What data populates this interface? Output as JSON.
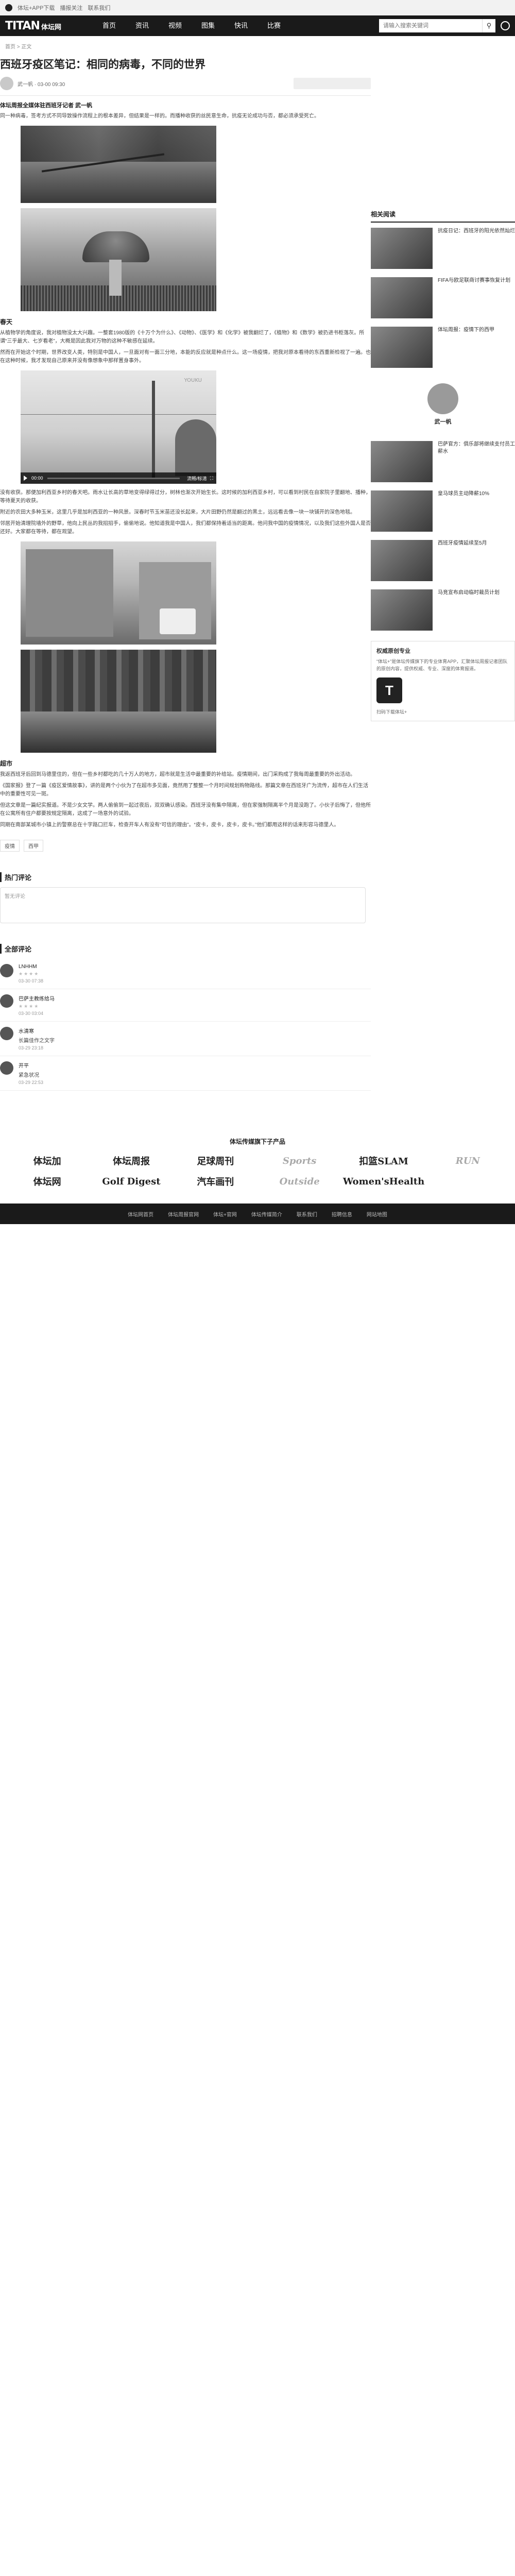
{
  "topbar": {
    "links": [
      "体坛+APP下载",
      "播报关注",
      "联系我们"
    ]
  },
  "nav": {
    "brand": "TITAN",
    "brand_sub": "体坛网",
    "menu": [
      "首页",
      "资讯",
      "视频",
      "图集",
      "快讯",
      "比赛"
    ],
    "search_placeholder": "请输入搜索关键词"
  },
  "breadcrumb": "首页 > 正文",
  "article": {
    "title": "西班牙疫区笔记：相同的病毒，不同的世界",
    "author_line": "武一帆 · 03-00 09:30",
    "summary": "体坛周报全媒体驻西班牙记者 武一帆",
    "intro": "同一种病毒，签考方式不同导致操作流程上的根本差异，但结果是一样的。而播种收获的丝民意生命，抗疫无论成功与否，都必须承受死亡。",
    "s1_head": "春天",
    "s1_p1": "从植物学的角度说，我对植物没太大兴趣。一整套1980版的《十万个为什么》、《动物》、《医学》和《化学》被我翻烂了，《植物》和《数学》被扔进书柜落灰。所谓“三乎最大、七岁看老”，大概是因此我对万物的这种不敏感在延续。",
    "s1_p2": "然而在开始这个时期，世界改变人类，特别是中国人，一旦面对有一面三分地，本能的反应就是种点什么。这一场疫情，把我对原本看待的东西重新检视了一遍。也在这种时候，我才发现自己原来并没有像想象中那样置身事外。",
    "s2_p1": "没有收获。那便加利西亚乡村的春天吧。雨水让长高的草地变得绿得过分，树林也渐次开始生长。这时候的加利西亚乡村，可以看到村民在自家院子里翻地、播种，等待夏天的收获。",
    "s2_p2": "附近的农田大多种玉米，这里几乎是加利西亚的一种风景。深春时节玉米苗还没长起来，大片田野仍然是翻过的黑土，远远看去像一块一块铺开的深色地毯。",
    "s2_p3": "邻居开始清理院墙外的野草，他向上民丛的我招招手，偷偷地说。他知道我是中国人，我们都保持着适当的距离。他问我中国的疫情情况，以及我们这些外国人是否还好。大家都在等待，都在观望。",
    "s3_head": "超市",
    "s3_p1": "我返西班牙后回到马德里住的，但在一些乡村都吃的几十万人的地方，超市就是生活中最重要的补给站。疫情期间，出门采购成了我每周最重要的外出活动。",
    "s3_p2": "《国家报》登了一篇《疫区爱情故事》，讲的是两个小伙为了在超市多见面，竟然用了整整一个月时间规划购物路线。那篇文章在西班牙广为流传，超市在人们生活中的重要性可见一斑。",
    "s3_p3": "但这文章是一篇纪实报道。不是少女文学。两人偷偷到一起过夜后，双双确认感染。西班牙没有集中隔离，但在家强制隔离半个月是没跑了。小伙子后悔了，但他所在公寓所有住户都要按规定隔离，这成了一场意外的试验。",
    "s3_p4": "同期在南部某城市小镇上的警察总在十字路口拦车，检查开车人有没有“可信的理由”。“皮卡，皮卡，皮卡，皮卡。”他们都用这样的话来形容马德里人。",
    "tags": [
      "疫情",
      "西甲"
    ]
  },
  "video": {
    "watermark": "YOUKU",
    "time": "00:00",
    "quality": "流畅/标清"
  },
  "comments_section": {
    "hot_title": "热门评论",
    "box_placeholder": "暂无评论",
    "all_title": "全部评论",
    "items": [
      {
        "name": "LNHHM",
        "text": "",
        "time": "03-30 07:38"
      },
      {
        "name": "巴萨主教练给马",
        "text": "",
        "time": "03-30 03:04"
      },
      {
        "name": "水清寒",
        "text": "长篇佳作之文字",
        "time": "03-29 23:18"
      },
      {
        "name": "开平",
        "text": "紧急状况",
        "time": "03-29 22:53"
      }
    ]
  },
  "sidebar": {
    "related_title": "相关阅读",
    "items": [
      {
        "title": "抗疫日记：西班牙的阳光依然灿烂"
      },
      {
        "title": "FIFA与欧足联商讨赛事恢复计划"
      },
      {
        "title": "体坛周报：疫情下的西甲"
      }
    ],
    "profile_name": "武一帆",
    "profile_items": [
      {
        "title": "巴萨官方：俱乐部将继续支付员工薪水"
      },
      {
        "title": "皇马球员主动降薪10%"
      },
      {
        "title": "西班牙疫情延续至5月"
      },
      {
        "title": "马竞宣布启动临时裁员计划"
      }
    ],
    "box_title": "权威原创专业",
    "box_body": "“体坛+”是体坛传媒旗下的专业体育APP，汇聚体坛周报记者团队的原创内容，提供权威、专业、深度的体育报道。",
    "box_logo": "T",
    "box_note": "扫码下载体坛+"
  },
  "footer": {
    "products_title": "体坛传媒旗下子产品",
    "logos": [
      "体坛加",
      "体坛周报",
      "足球周刊",
      "Sports",
      "扣篮SLAM",
      "RUN",
      "体坛网",
      "Golf Digest",
      "汽车画刊",
      "Outside",
      "Women'sHealth",
      ""
    ],
    "links": [
      "体坛网首页",
      "体坛周报官网",
      "体坛+官网",
      "体坛传媒简介",
      "联系我们",
      "招聘信息",
      "网站地图"
    ]
  }
}
